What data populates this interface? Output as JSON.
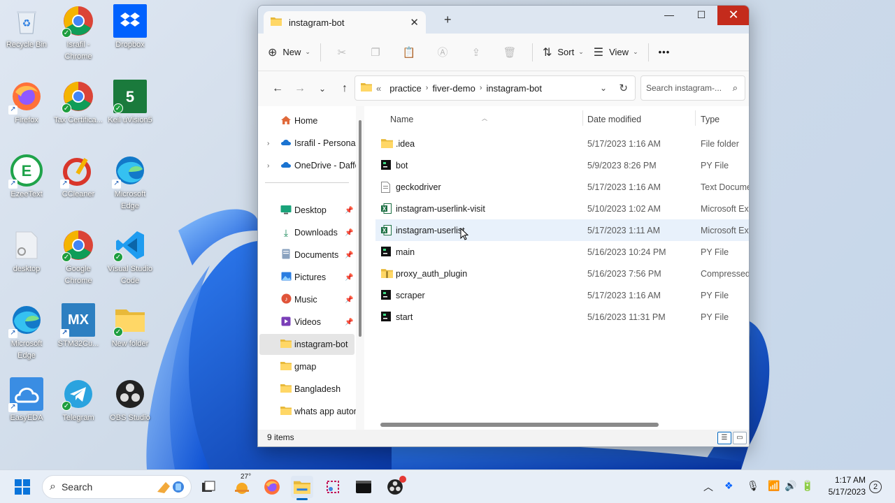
{
  "desktop": {
    "icons": [
      {
        "label": "Recycle Bin"
      },
      {
        "label": "Israfil - Chrome"
      },
      {
        "label": "Dropbox"
      },
      {
        "label": "Firefox"
      },
      {
        "label": "Tax Certifica..."
      },
      {
        "label": "Keil uVision5"
      },
      {
        "label": "EzeeText"
      },
      {
        "label": "CCleaner"
      },
      {
        "label": "Microsoft Edge"
      },
      {
        "label": "desktop"
      },
      {
        "label": "Google Chrome"
      },
      {
        "label": "Visual Studio Code"
      },
      {
        "label": "Microsoft Edge"
      },
      {
        "label": "STM32Cu..."
      },
      {
        "label": "New folder"
      },
      {
        "label": "EasyEDA"
      },
      {
        "label": "Telegram"
      },
      {
        "label": "OBS Studio"
      }
    ],
    "icon_glyphs": {
      "keil": "5",
      "stm": "MX"
    }
  },
  "window": {
    "tab_title": "instagram-bot",
    "tab_close": "✕",
    "new_tab": "+",
    "minimize": "—",
    "maximize": "☐",
    "close": "✕"
  },
  "toolbar": {
    "new_label": "New",
    "sort_label": "Sort",
    "view_label": "View",
    "more": "•••"
  },
  "address": {
    "overflow": "«",
    "crumbs": [
      "practice",
      "fiver-demo",
      "instagram-bot"
    ],
    "search_placeholder": "Search instagram-..."
  },
  "nav": {
    "home": "Home",
    "cloud1": "Israfil - Personal",
    "cloud2": "OneDrive - Daffo",
    "quick": [
      "Desktop",
      "Downloads",
      "Documents",
      "Pictures",
      "Music",
      "Videos"
    ],
    "folders": [
      "instagram-bot",
      "gmap",
      "Bangladesh",
      "whats app autom"
    ]
  },
  "columns": {
    "name": "Name",
    "date": "Date modified",
    "type": "Type"
  },
  "files": [
    {
      "name": ".idea",
      "date": "5/17/2023 1:16 AM",
      "type": "File folder",
      "icon": "folder-icon"
    },
    {
      "name": "bot",
      "date": "5/9/2023 8:26 PM",
      "type": "PY File",
      "icon": "py-file-icon"
    },
    {
      "name": "geckodriver",
      "date": "5/17/2023 1:16 AM",
      "type": "Text Document",
      "icon": "text-file-icon"
    },
    {
      "name": "instagram-userlink-visit",
      "date": "5/10/2023 1:02 AM",
      "type": "Microsoft Excel",
      "icon": "excel-file-icon"
    },
    {
      "name": "instagram-userlist",
      "date": "5/17/2023 1:11 AM",
      "type": "Microsoft Excel",
      "icon": "excel-file-icon"
    },
    {
      "name": "main",
      "date": "5/16/2023 10:24 PM",
      "type": "PY File",
      "icon": "py-file-icon"
    },
    {
      "name": "proxy_auth_plugin",
      "date": "5/16/2023 7:56 PM",
      "type": "Compressed (zipped)",
      "icon": "zip-folder-icon"
    },
    {
      "name": "scraper",
      "date": "5/17/2023 1:16 AM",
      "type": "PY File",
      "icon": "py-file-icon"
    },
    {
      "name": "start",
      "date": "5/16/2023 11:31 PM",
      "type": "PY File",
      "icon": "py-file-icon"
    }
  ],
  "status": {
    "items": "9 items"
  },
  "taskbar": {
    "search_label": "Search",
    "weather_temp": "27°",
    "time": "1:17 AM",
    "date": "5/17/2023",
    "notifications": "2"
  },
  "colors": {
    "accent": "#0067c0",
    "folder": "#f4c542",
    "close_red": "#c42b1c",
    "excel": "#1d7044"
  }
}
